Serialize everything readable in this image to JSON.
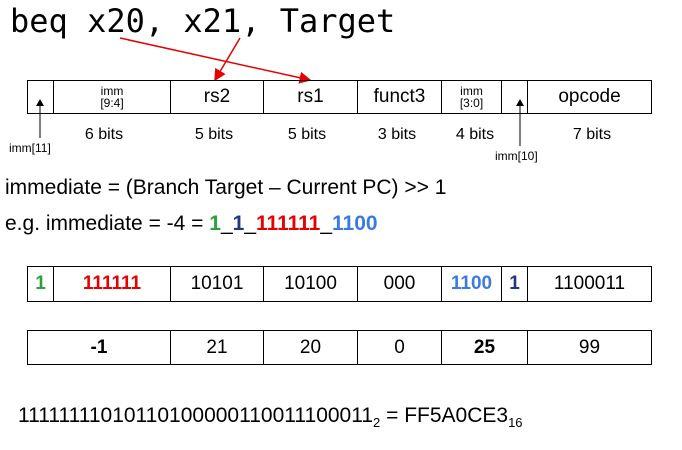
{
  "title": "beq x20, x21, Target",
  "format_fields": [
    {
      "name": "",
      "sub": ""
    },
    {
      "name": "imm",
      "sub": "[9:4]"
    },
    {
      "name": "rs2",
      "sub": ""
    },
    {
      "name": "rs1",
      "sub": ""
    },
    {
      "name": "funct3",
      "sub": ""
    },
    {
      "name": "imm",
      "sub": "[3:0]"
    },
    {
      "name": "",
      "sub": ""
    },
    {
      "name": "opcode",
      "sub": ""
    }
  ],
  "bit_widths": [
    "6 bits",
    "5 bits",
    "5 bits",
    "3 bits",
    "4 bits",
    "7 bits"
  ],
  "imm11_label": "imm[11]",
  "imm10_label": "imm[10]",
  "formula": "immediate = (Branch Target – Current PC) >> 1",
  "example": {
    "prefix": "e.g. immediate = -4 = ",
    "p1": "1",
    "sep1": "_",
    "p2": "1",
    "sep2": "_",
    "p3": "111111",
    "sep3": "_",
    "p4": "1100"
  },
  "binary_row": [
    "1",
    "111111",
    "10101",
    "10100",
    "000",
    "1100",
    "1",
    "1100011"
  ],
  "decimal_row": [
    "-1",
    "21",
    "20",
    "0",
    "25",
    "99"
  ],
  "result": {
    "binary": "11111111010110100000110011100011",
    "binary_sub": "2",
    "equals": " = ",
    "hex": "FF5A0CE3",
    "hex_sub": "16"
  },
  "colors": {
    "green": "#2aa13b",
    "navy": "#1f3a7a",
    "red": "#e60000",
    "blue": "#3a7be0",
    "arrow": "#e60000"
  }
}
